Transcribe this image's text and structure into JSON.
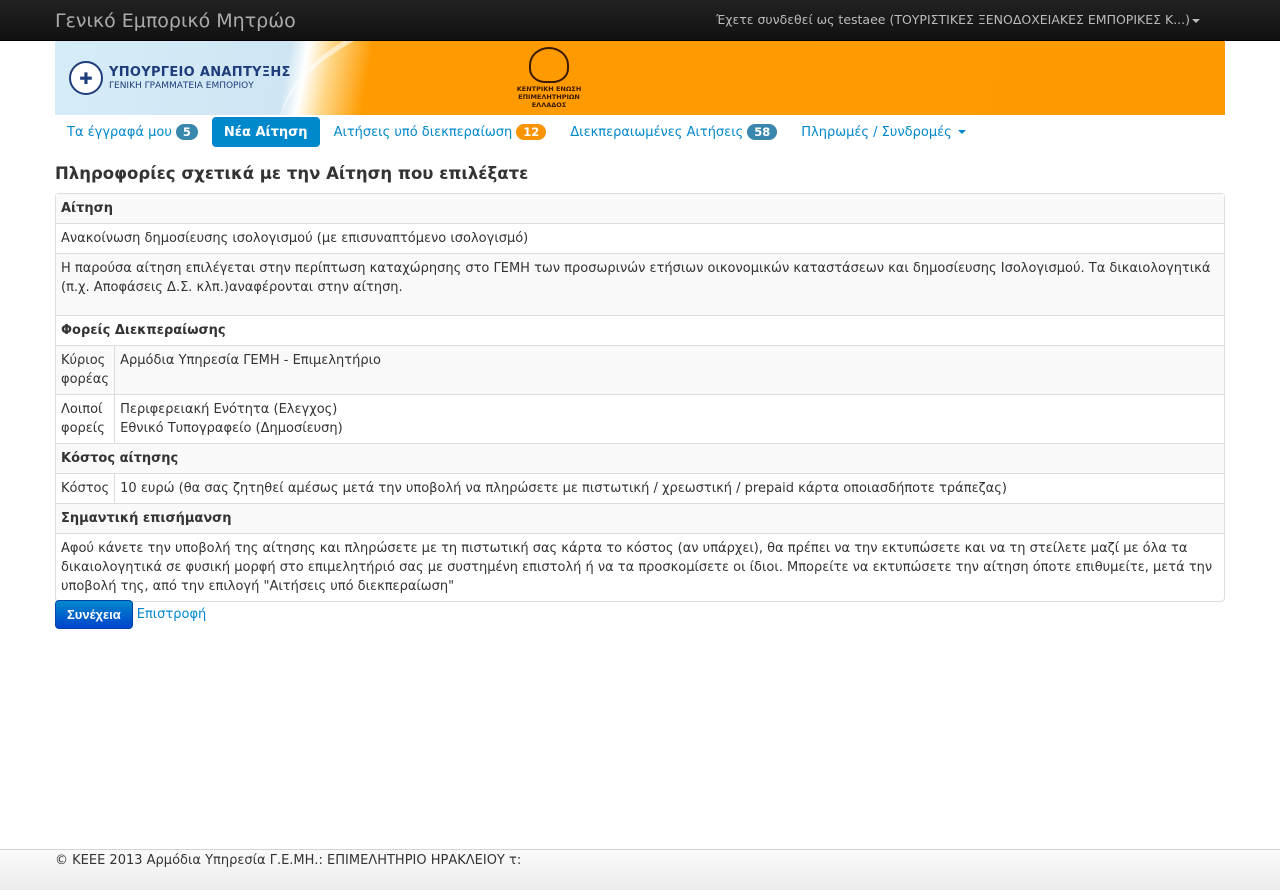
{
  "header": {
    "brand": "Γενικό Εμπορικό Μητρώο",
    "user_text": "Έχετε συνδεθεί ως testaee (ΤΟΥΡΙΣΤΙΚΕΣ ΞΕΝΟΔΟΧΕΙΑΚΕΣ ΕΜΠΟΡΙΚΕΣ Κ...)"
  },
  "banner": {
    "ministry_line1": "ΥΠΟΥΡΓΕΙΟ ΑΝΑΠΤΥΞΗΣ",
    "ministry_line2": "ΓΕΝΙΚΗ ΓΡΑΜΜΑΤΕΙΑ ΕΜΠΟΡΙΟΥ",
    "keee_text": "ΚΕΝΤΡΙΚΗ ΕΝΩΣΗ ΕΠΙΜΕΛΗΤΗΡΙΩΝ ΕΛΛΑΔΟΣ"
  },
  "nav": {
    "my_docs": {
      "label": "Τα έγγραφά μου",
      "count": "5"
    },
    "new_request": {
      "label": "Νέα Αίτηση"
    },
    "pending": {
      "label": "Αιτήσεις υπό διεκπεραίωση",
      "count": "12"
    },
    "completed": {
      "label": "Διεκπεραιωμένες Αιτήσεις",
      "count": "58"
    },
    "payments": {
      "label": "Πληρωμές / Συνδρομές"
    }
  },
  "page": {
    "title": "Πληροφορίες σχετικά με την Αίτηση που επιλέξατε"
  },
  "info": {
    "request_header": "Αίτηση",
    "request_name": "Ανακοίνωση δημοσίευσης ισολογισμού (με επισυναπτόμενο ισολογισμό)",
    "request_desc": "Η παρούσα αίτηση επιλέγεται στην περίπτωση καταχώρησης στο ΓΕΜΗ των προσωρινών ετήσιων οικονομικών καταστάσεων και δημοσίευσης Ισολογισμού. Τα δικαιολογητικά (π.χ. Αποφάσεις Δ.Σ. κλπ.)αναφέρονται στην αίτηση.",
    "agencies_header": "Φορείς Διεκπεραίωσης",
    "main_agency_label": "Κύριος φορέας",
    "main_agency_value": "Αρμόδια Υπηρεσία ΓΕΜΗ - Επιμελητήριο",
    "other_agencies_label": "Λοιποί φορείς",
    "other_agency_1": "Περιφερειακή Ενότητα (Ελεγχος)",
    "other_agency_2": "Εθνικό Τυπογραφείο (Δημοσίευση)",
    "cost_header": "Κόστος αίτησης",
    "cost_label": "Κόστος",
    "cost_value": "10 ευρώ (θα σας ζητηθεί αμέσως μετά την υποβολή να πληρώσετε με πιστωτική / χρεωστική / prepaid κάρτα οποιασδήποτε τράπεζας)",
    "notice_header": "Σημαντική επισήμανση",
    "notice_text": "Αφού κάνετε την υποβολή της αίτησης και πληρώσετε με τη πιστωτική σας κάρτα το κόστος (αν υπάρχει), θα πρέπει να την εκτυπώσετε και να τη στείλετε μαζί με όλα τα δικαιολογητικά σε φυσική μορφή στο επιμελητήριό σας με συστημένη επιστολή ή να τα προσκομίσετε οι ίδιοι. Μπορείτε να εκτυπώσετε την αίτηση όποτε επιθυμείτε, μετά την υποβολή της, από την επιλογή \"Αιτήσεις υπό διεκπεραίωση\""
  },
  "actions": {
    "continue_label": "Συνέχεια",
    "back_label": "Επιστροφή"
  },
  "footer": {
    "text": "© ΚΕΕΕ 2013 Αρμόδια Υπηρεσία Γ.Ε.ΜΗ.: ΕΠΙΜΕΛΗΤΗΡΙΟ ΗΡΑΚΛΕΙΟΥ τ:"
  }
}
